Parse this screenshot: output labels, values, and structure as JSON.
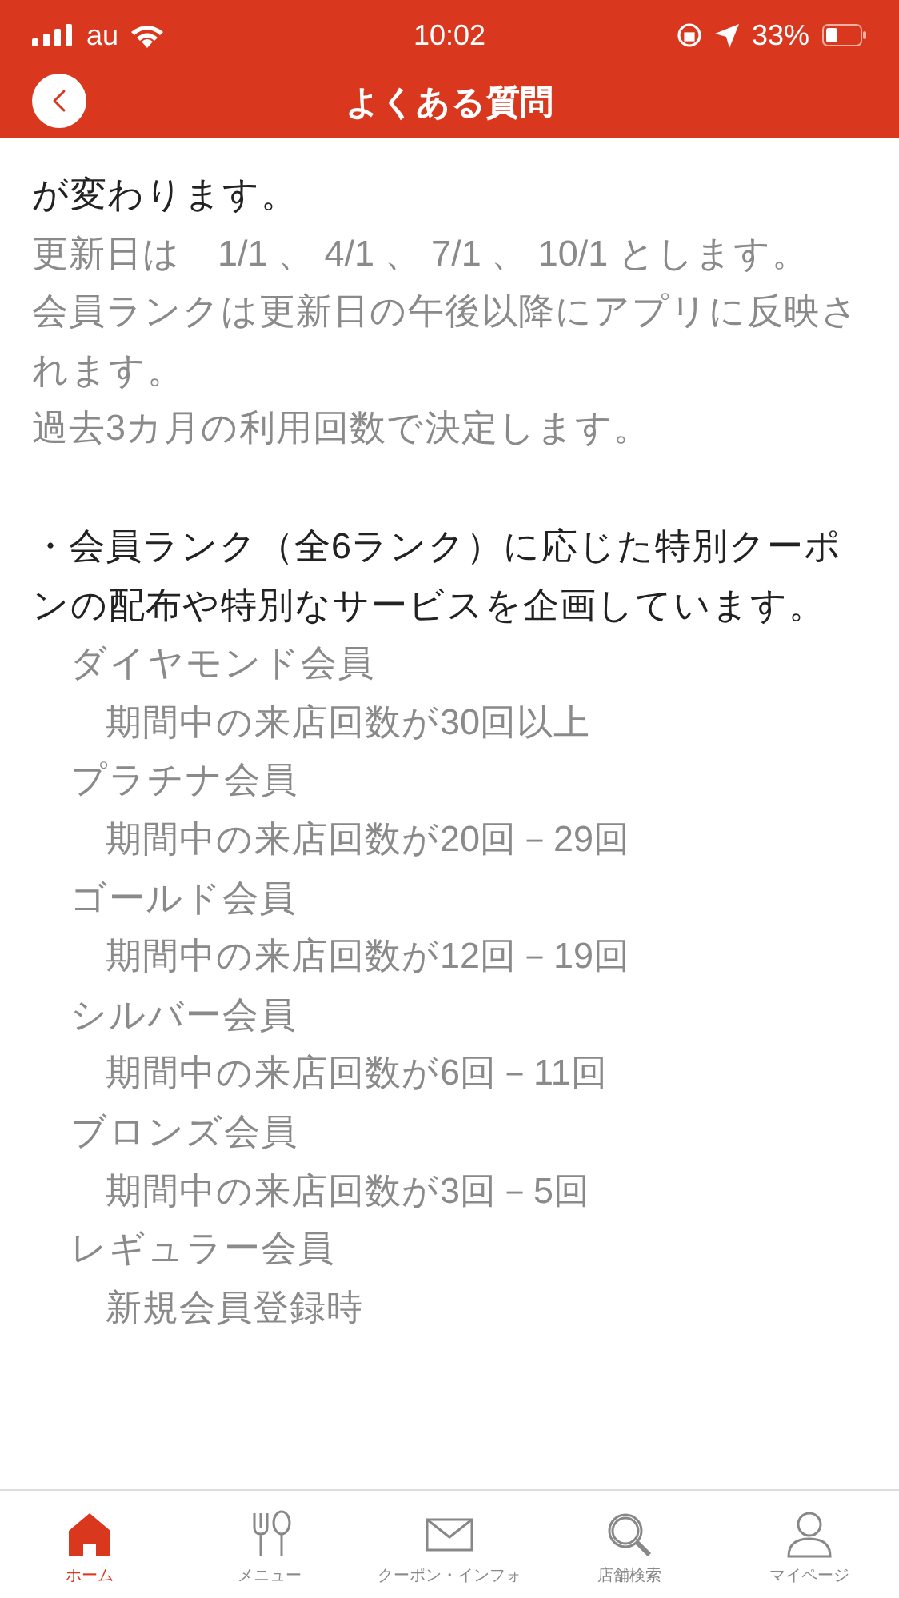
{
  "status_bar": {
    "carrier": "au",
    "time": "10:02",
    "battery": "33%"
  },
  "header": {
    "title": "よくある質問"
  },
  "content": [
    {
      "kind": "main",
      "text": "が変わります。"
    },
    {
      "kind": "note",
      "text": "更新日は　1/1 、 4/1 、 7/1 、 10/1 とします。"
    },
    {
      "kind": "note",
      "text": "会員ランクは更新日の午後以降にアプリに反映されます。"
    },
    {
      "kind": "note",
      "text": "過去3カ月の利用回数で決定します。"
    },
    {
      "kind": "gap"
    },
    {
      "kind": "main",
      "text": "・会員ランク（全6ランク）に応じた特別クーポンの配布や特別なサービスを企画しています。"
    }
  ],
  "ranks": [
    {
      "name": "ダイヤモンド会員",
      "condition": "期間中の来店回数が30回以上"
    },
    {
      "name": "プラチナ会員",
      "condition": "期間中の来店回数が20回－29回"
    },
    {
      "name": "ゴールド会員",
      "condition": "期間中の来店回数が12回－19回"
    },
    {
      "name": "シルバー会員",
      "condition": "期間中の来店回数が6回－11回"
    },
    {
      "name": "ブロンズ会員",
      "condition": "期間中の来店回数が3回－5回"
    },
    {
      "name": "レギュラー会員",
      "condition": "新規会員登録時"
    }
  ],
  "tabs": [
    {
      "kind": "home",
      "label": "ホーム",
      "selected": true
    },
    {
      "kind": "menu",
      "label": "メニュー",
      "selected": false
    },
    {
      "kind": "mail",
      "label": "クーポン・インフォ",
      "selected": false
    },
    {
      "kind": "search",
      "label": "店舗検索",
      "selected": false
    },
    {
      "kind": "user",
      "label": "マイページ",
      "selected": false
    }
  ]
}
